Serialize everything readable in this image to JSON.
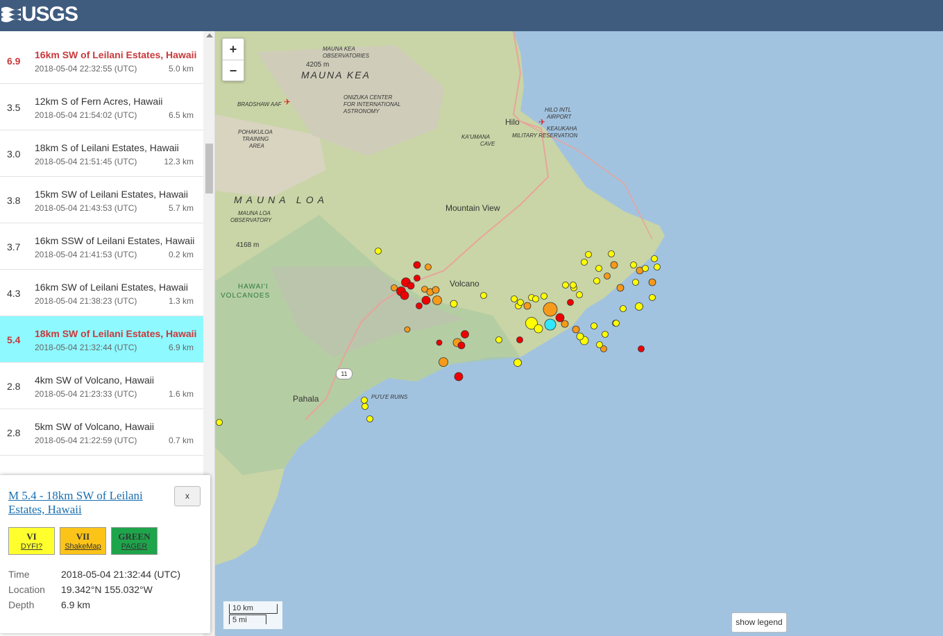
{
  "header": {
    "logo_text": "USGS"
  },
  "events": [
    {
      "mag": "6.9",
      "place": "16km SW of Leilani Estates, Hawaii",
      "time": "2018-05-04 22:32:55 (UTC)",
      "depth": "5.0 km"
    },
    {
      "mag": "3.5",
      "place": "12km S of Fern Acres, Hawaii",
      "time": "2018-05-04 21:54:02 (UTC)",
      "depth": "6.5 km"
    },
    {
      "mag": "3.0",
      "place": "18km S of Leilani Estates, Hawaii",
      "time": "2018-05-04 21:51:45 (UTC)",
      "depth": "12.3 km"
    },
    {
      "mag": "3.8",
      "place": "15km SW of Leilani Estates, Hawaii",
      "time": "2018-05-04 21:43:53 (UTC)",
      "depth": "5.7 km"
    },
    {
      "mag": "3.7",
      "place": "16km SSW of Leilani Estates, Hawaii",
      "time": "2018-05-04 21:41:53 (UTC)",
      "depth": "0.2 km"
    },
    {
      "mag": "4.3",
      "place": "16km SW of Leilani Estates, Hawaii",
      "time": "2018-05-04 21:38:23 (UTC)",
      "depth": "1.3 km"
    },
    {
      "mag": "5.4",
      "place": "18km SW of Leilani Estates, Hawaii",
      "time": "2018-05-04 21:32:44 (UTC)",
      "depth": "6.9 km"
    },
    {
      "mag": "2.8",
      "place": "4km SW of Volcano, Hawaii",
      "time": "2018-05-04 21:23:33 (UTC)",
      "depth": "1.6 km"
    },
    {
      "mag": "2.8",
      "place": "5km SW of Volcano, Hawaii",
      "time": "2018-05-04 21:22:59 (UTC)",
      "depth": "0.7 km"
    }
  ],
  "detail": {
    "title": "M 5.4 - 18km SW of Leilani Estates, Hawaii",
    "close_label": "x",
    "dyfi_value": "VI",
    "dyfi_label": "DYFI?",
    "dyfi_color": "#ffff2e",
    "shakemap_value": "VII",
    "shakemap_label": "ShakeMap",
    "shakemap_color": "#fcc419",
    "pager_value": "GREEN",
    "pager_label": "PAGER",
    "pager_color": "#1ea54b",
    "time_label": "Time",
    "time_value": "2018-05-04 21:32:44 (UTC)",
    "location_label": "Location",
    "location_value": "19.342°N 155.032°W",
    "depth_label": "Depth",
    "depth_value": "6.9 km"
  },
  "map": {
    "zoom_in": "+",
    "zoom_out": "−",
    "scale_km": "10 km",
    "scale_mi": "5 mi",
    "legend_button": "show legend",
    "labels": {
      "mauna_kea_obs1": "MAUNA KEA",
      "mauna_kea_obs2": "OBSERVATORIES",
      "mauna_kea_elev": "4205 m",
      "mauna_kea": "MAUNA KEA",
      "bradshaw": "BRADSHAW AAF",
      "onizuka1": "ONIZUKA CENTER",
      "onizuka2": "FOR INTERNATIONAL",
      "onizuka3": "ASTRONOMY",
      "hilo_airport1": "HILO INTL",
      "hilo_airport2": "AIRPORT",
      "hilo": "Hilo",
      "keaukaha1": "KEAUKAHA",
      "keaukaha2": "MILITARY RESERVATION",
      "kaumana1": "KA'UMANA",
      "kaumana2": "CAVE",
      "pohakuloa1": "POHAKULOA",
      "pohakuloa2": "TRAINING",
      "pohakuloa3": "AREA",
      "mauna_loa": "MAUNA LOA",
      "mauna_loa_obs1": "MAUNA LOA",
      "mauna_loa_obs2": "OBSERVATORY",
      "mauna_loa_elev": "4168 m",
      "mountain_view": "Mountain View",
      "volcano": "Volcano",
      "hawaii_volcanoes1": "HAWAI'I",
      "hawaii_volcanoes2": "VOLCANOES",
      "route": "11",
      "pahala": "Pahala",
      "ruins": "PU'U'E RUINS"
    }
  }
}
